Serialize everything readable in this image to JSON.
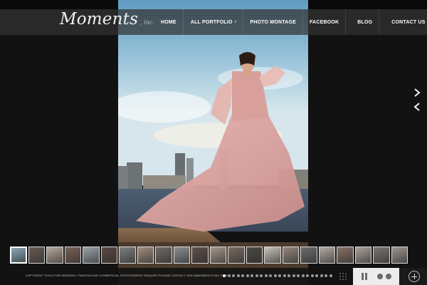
{
  "brand": {
    "name": "Moments",
    "suffix": ", inc."
  },
  "nav": [
    {
      "label": "HOME",
      "has_dropdown": false
    },
    {
      "label": "ALL PORTFOLIO",
      "has_dropdown": true
    },
    {
      "label": "PHOTO MONTAGE",
      "has_dropdown": false
    },
    {
      "label": "FACEBOOK",
      "has_dropdown": false
    },
    {
      "label": "BLOG",
      "has_dropdown": false
    },
    {
      "label": "CONTACT US",
      "has_dropdown": false
    }
  ],
  "slider": {
    "next_icon": "chevron-right-icon",
    "prev_icon": "chevron-left-icon",
    "thumbnail_count": 22,
    "active_thumbnail": 1,
    "dot_count": 24,
    "active_dot": 1
  },
  "footer": {
    "copyright": "COPYRIGHT ©2014 FOR WEDDING, FASHION AND COMMERCIAL PHOTOGRAPHY ENQUIRY PLEASE CONTACT CEKO@MOMENTS-INC.COM"
  },
  "controls": {
    "grid_icon": "grid-icon",
    "pause_icon": "pause-icon",
    "prev_icon": "circle-prev-icon",
    "next_icon": "circle-next-icon",
    "expand_icon": "plus-icon"
  },
  "colors": {
    "background": "#121212",
    "header_bar": "#323232",
    "control_panel": "#ececec",
    "accent_white": "#ffffff"
  }
}
